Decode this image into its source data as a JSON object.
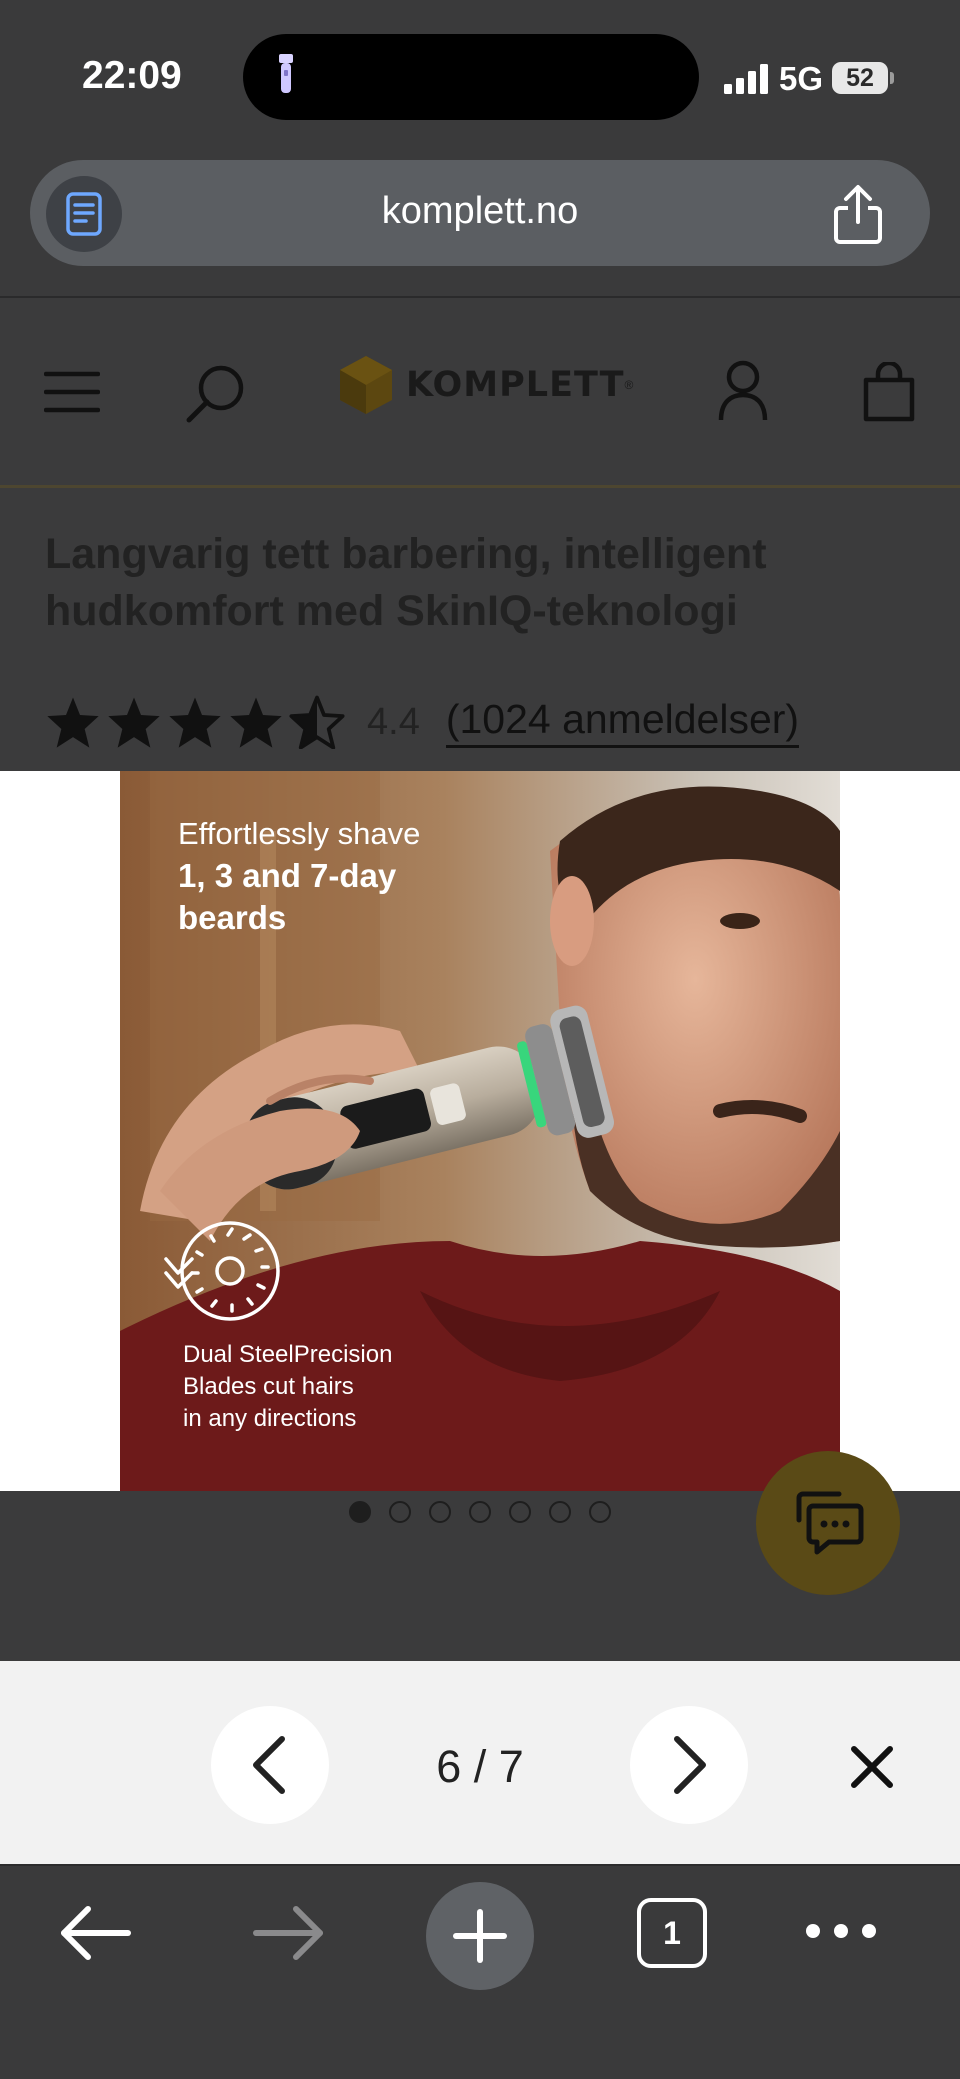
{
  "status_bar": {
    "time": "22:09",
    "network": "5G",
    "battery": "52"
  },
  "browser": {
    "url": "komplett.no",
    "tab_count": "1"
  },
  "site": {
    "logo_text": "KOMPLETT",
    "logo_mark": "®"
  },
  "product": {
    "title": "Langvarig tett barbering, intelligent hudkomfort med SkinIQ-teknologi",
    "rating": 4.4,
    "rating_text": "4.4",
    "reviews": "(1024 anmeldelser)"
  },
  "image": {
    "headline_line1": "Effortlessly shave",
    "headline_line2": "1, 3 and 7-day",
    "headline_line3": "beards",
    "caption_line1": "Dual SteelPrecision",
    "caption_line2": "Blades cut hairs",
    "caption_line3": "in any directions"
  },
  "gallery": {
    "counter": "6 / 7",
    "current": 6,
    "total": 7
  },
  "colors": {
    "brand": "#f2a900",
    "overlay": "#3b3b3c",
    "nav_bg": "#f2f2f2"
  },
  "icons": [
    "flashlight-icon",
    "signal-icon",
    "reader-icon",
    "share-icon",
    "menu-icon",
    "search-icon",
    "user-icon",
    "cart-icon",
    "chat-icon",
    "chevron-left-icon",
    "chevron-right-icon",
    "close-icon",
    "back-arrow-icon",
    "forward-arrow-icon",
    "plus-icon",
    "more-icon"
  ]
}
